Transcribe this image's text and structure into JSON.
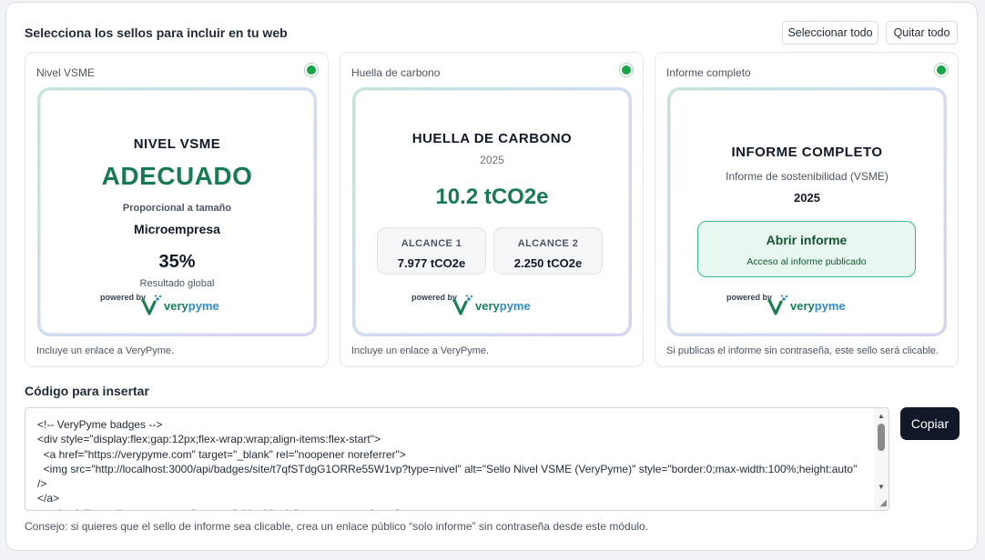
{
  "header": {
    "title": "Selecciona los sellos para incluir en tu web",
    "select_all": "Seleccionar todo",
    "clear_all": "Quitar todo"
  },
  "cards": [
    {
      "label": "Nivel VSME",
      "selected": true,
      "footer": "Incluye un enlace a VeryPyme.",
      "badge": {
        "title": "NIVEL VSME",
        "level": "ADECUADO",
        "proportional": "Proporcional a tamaño",
        "size": "Microempresa",
        "score": "35%",
        "score_label": "Resultado global"
      }
    },
    {
      "label": "Huella de carbono",
      "selected": true,
      "footer": "Incluye un enlace a VeryPyme.",
      "badge": {
        "title": "HUELLA DE CARBONO",
        "year": "2025",
        "total": "10.2 tCO2e",
        "scopes": [
          {
            "label": "ALCANCE 1",
            "value": "7.977 tCO2e"
          },
          {
            "label": "ALCANCE 2",
            "value": "2.250 tCO2e"
          }
        ]
      }
    },
    {
      "label": "Informe completo",
      "selected": true,
      "footer": "Si publicas el informe sin contraseña, este sello será clicable.",
      "badge": {
        "title": "INFORME COMPLETO",
        "subtitle": "Informe de sostenibilidad (VSME)",
        "year": "2025",
        "cta_title": "Abrir informe",
        "cta_sub": "Acceso al informe publicado"
      }
    }
  ],
  "branding": {
    "powered": "powered by",
    "logo_text_a": "very",
    "logo_text_b": "pyme",
    "brand_color": "#1a7f57",
    "accent_color": "#2e8bd0"
  },
  "embed": {
    "label": "Código para insertar",
    "code": "<!-- VeryPyme badges -->\n<div style=\"display:flex;gap:12px;flex-wrap:wrap;align-items:flex-start\">\n  <a href=\"https://verypyme.com\" target=\"_blank\" rel=\"noopener noreferrer\">\n  <img src=\"http://localhost:3000/api/badges/site/t7qfSTdgG1ORRe55W1vp?type=nivel\" alt=\"Sello Nivel VSME (VeryPyme)\" style=\"border:0;max-width:100%;height:auto\"\n/>\n</a>\n  <a href=\"https://verypyme.com\" target=\"_blank\" rel=\"noopener noreferrer\">",
    "copy": "Copiar",
    "tip": "Consejo: si quieres que el sello de informe sea clicable, crea un enlace público “solo informe” sin contraseña desde este módulo."
  },
  "colors": {
    "selected_dot": "#16a34a",
    "dark_button": "#111827"
  }
}
